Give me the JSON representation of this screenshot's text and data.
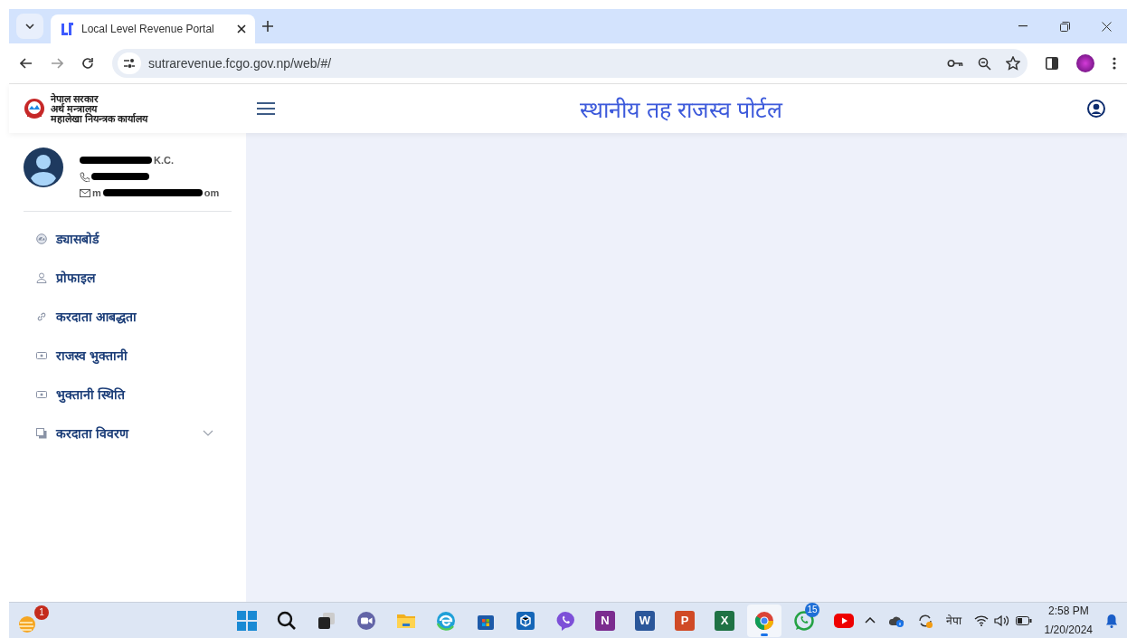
{
  "browser": {
    "tab": {
      "title": "Local Level Revenue Portal",
      "selected": true
    },
    "address": "sutrarevenue.fcgo.gov.np/web/#/"
  },
  "header": {
    "org_lines": [
      "नेपाल सरकार",
      "अर्थ मन्त्रालय",
      "महालेखा नियन्त्रक कार्यालय"
    ],
    "title": "स्थानीय तह राजस्व पोर्टल"
  },
  "user": {
    "name_end": "K.C.",
    "email_start": "m",
    "email_end": "om"
  },
  "menu": [
    {
      "label": "ड्यासबोर्ड",
      "kind": "dashboard"
    },
    {
      "label": "प्रोफाइल",
      "kind": "user"
    },
    {
      "label": "करदाता आबद्धता",
      "kind": "link"
    },
    {
      "label": "राजस्व भुक्तानी",
      "kind": "cash"
    },
    {
      "label": "भुक्तानी स्थिति",
      "kind": "cash"
    },
    {
      "label": "करदाता विवरण",
      "kind": "copy",
      "expanded": false
    }
  ],
  "taskbar": {
    "weather_badge": "1",
    "apps": [
      {
        "kind": "start",
        "selected": false
      },
      {
        "kind": "search",
        "selected": false
      },
      {
        "kind": "taskview",
        "selected": false
      },
      {
        "kind": "meet",
        "selected": false
      },
      {
        "kind": "folder",
        "selected": false
      },
      {
        "kind": "edge",
        "selected": false
      },
      {
        "kind": "store",
        "selected": false
      },
      {
        "kind": "cube",
        "selected": false
      },
      {
        "kind": "viber",
        "selected": false
      },
      {
        "kind": "office",
        "letter": "N",
        "color": "#7b2c8f",
        "selected": false
      },
      {
        "kind": "office",
        "letter": "W",
        "color": "#2b579a",
        "selected": false
      },
      {
        "kind": "office",
        "letter": "P",
        "color": "#d04a26",
        "selected": false
      },
      {
        "kind": "office",
        "letter": "X",
        "color": "#1f7244",
        "selected": false
      },
      {
        "kind": "chrome",
        "selected": true
      },
      {
        "kind": "whatsapp",
        "badge": "15",
        "selected": false
      },
      {
        "kind": "youtube",
        "selected": false
      }
    ],
    "language": "नेपा",
    "time": "2:58 PM",
    "date": "1/20/2024"
  }
}
